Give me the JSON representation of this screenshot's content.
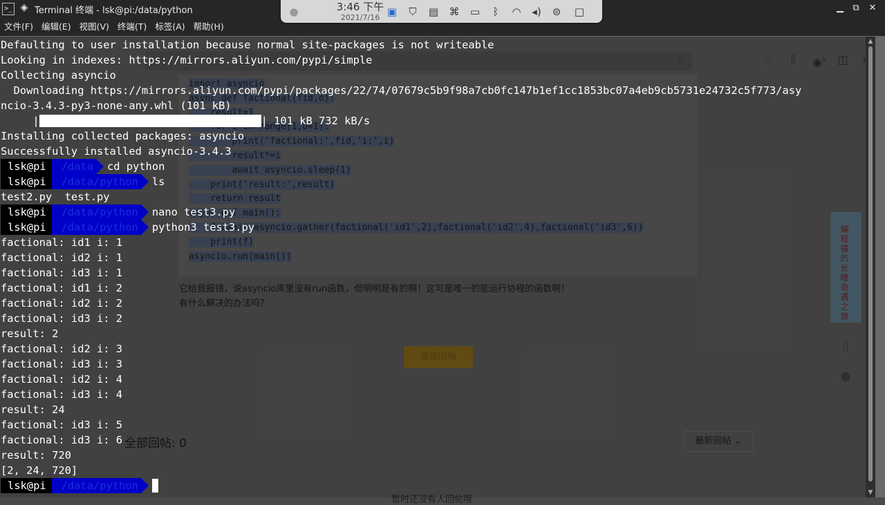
{
  "background_page": {
    "url_icons": [
      "star-icon",
      "pocket-icon",
      "download-icon",
      "ublock-icon",
      "reader-icon",
      "menu-icon"
    ],
    "ublock_badge": "5",
    "code_lines": [
      "import asyncio",
      "async def factional(fid,o):",
      "    result=1",
      "    for i in range(1,o+1):",
      "        print('factional:',fid,'i:',i)",
      "        result*=i",
      "        await asyncio.sleep(1)",
      "    print('result:',result)",
      "    return result",
      "async def main():",
      "    f=await asyncio.gather(factional('id1',2),factional('id2',4),factional('id3',6))",
      "    print(f)",
      "asyncio.run(main())"
    ],
    "post_line1": "它给我报错，说asyncio库里没有run函数，但明明是有的啊！这可是唯一的能运行协程的函数啊！",
    "post_line2": "有什么解决的办法吗？",
    "add_reply_button": "添加回帖",
    "reply_count": "全部回帖: 0",
    "sort_select": "最新回帖",
    "footer_text": "暂时还没有人回帖哦",
    "banner_text": "编程猫的长睫奇遇之旅"
  },
  "tray": {
    "time": "3:46 下午",
    "date": "2021/7/16"
  },
  "window": {
    "title": "Terminal 终端 - lsk@pi:/data/python",
    "app_icon": ">_"
  },
  "menu": [
    {
      "label": "文件(F)"
    },
    {
      "label": "编辑(E)"
    },
    {
      "label": "视图(V)"
    },
    {
      "label": "终端(T)"
    },
    {
      "label": "标签(A)"
    },
    {
      "label": "帮助(H)"
    }
  ],
  "terminal": {
    "line_default": "Defaulting to user installation because normal site-packages is not writeable",
    "line_indexes": "Looking in indexes: https://mirrors.aliyun.com/pypi/simple",
    "line_collecting": "Collecting asyncio",
    "line_downloading": "  Downloading https://mirrors.aliyun.com/pypi/packages/22/74/07679c5b9f98a7cb0fc147b1ef1cc1853bc07a4eb9cb5731e24732c5f773/asy",
    "line_wheel": "ncio-3.4.3-py3-none-any.whl (101 kB)",
    "progress_prefix": "     |",
    "progress_fraction": 1.0,
    "progress_suffix": "| 101 kB 732 kB/s",
    "line_installing": "Installing collected packages: asyncio",
    "line_installed": "Successfully installed asyncio-3.4.3",
    "prompt_user": "lsk@pi",
    "cmd1_path": "/data",
    "cmd1": "cd python",
    "cmd2_path": "/data/python",
    "cmd2": "ls",
    "ls_output": "test2.py  test.py",
    "cmd3_path": "/data/python",
    "cmd3": "nano test3.py",
    "cmd4_path": "/data/python",
    "cmd4": "python3 test3.py",
    "output": [
      "factional: id1 i: 1",
      "factional: id2 i: 1",
      "factional: id3 i: 1",
      "factional: id1 i: 2",
      "factional: id2 i: 2",
      "factional: id3 i: 2",
      "result: 2",
      "factional: id2 i: 3",
      "factional: id3 i: 3",
      "factional: id2 i: 4",
      "factional: id3 i: 4",
      "result: 24",
      "factional: id3 i: 5",
      "factional: id3 i: 6",
      "result: 720",
      "[2, 24, 720]"
    ],
    "final_path": "/data/python"
  }
}
